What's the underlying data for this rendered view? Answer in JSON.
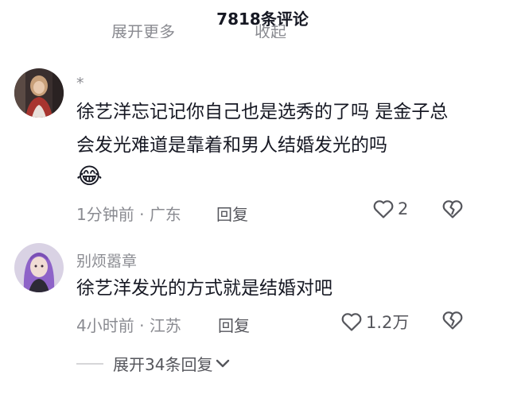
{
  "header": {
    "title": "7818条评论"
  },
  "clipped_above": {
    "left_text": "展开更多",
    "right_text": "收起"
  },
  "comments": [
    {
      "username": "*",
      "text": "徐艺洋忘记记你自己也是选秀的了吗 是金子总会发光难道是靠着和男人结婚发光的吗",
      "emoji": "😂",
      "time": "1分钟前",
      "location": "广东",
      "reply_label": "回复",
      "likes": "2"
    },
    {
      "username": "别烦嚣章",
      "text": "徐艺洋发光的方式就是结婚对吧",
      "time": "4小时前",
      "location": "江苏",
      "reply_label": "回复",
      "likes": "1.2万"
    }
  ],
  "expand_replies": {
    "label": "展开34条回复"
  },
  "icons": {
    "like": "heart-outline-icon",
    "dislike": "broken-heart-icon",
    "expand": "chevron-down-icon"
  },
  "colors": {
    "text": "#161823",
    "secondary": "#8a8b91",
    "action": "#55565c"
  }
}
